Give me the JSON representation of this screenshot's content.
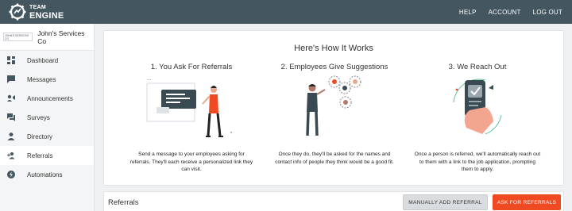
{
  "brand": {
    "line1": "TEAM",
    "line2": "ENGINE"
  },
  "topnav": {
    "help": "HELP",
    "account": "ACCOUNT",
    "logout": "LOG OUT"
  },
  "sidebar": {
    "company_logo_text": "JOHN'S SERVICES CO",
    "company_name": "John's Services Co",
    "items": [
      {
        "label": "Dashboard",
        "icon": "dashboard-icon"
      },
      {
        "label": "Messages",
        "icon": "message-icon"
      },
      {
        "label": "Announcements",
        "icon": "announcement-icon"
      },
      {
        "label": "Surveys",
        "icon": "survey-icon"
      },
      {
        "label": "Directory",
        "icon": "person-icon"
      },
      {
        "label": "Referrals",
        "icon": "referral-icon",
        "active": true
      },
      {
        "label": "Automations",
        "icon": "automation-icon"
      }
    ]
  },
  "how": {
    "title": "Here's How It Works",
    "steps": [
      {
        "title": "1. You Ask For Referrals",
        "desc": "Send a message to your employees asking for referrals. They'll each receive a personalized link they can visit."
      },
      {
        "title": "2. Employees Give Suggestions",
        "desc": "Once they do, they'll be asked for the names and contact info of people they think would be a good fit."
      },
      {
        "title": "3. We Reach Out",
        "desc": "Once a person is referred, we'll automatically reach out to them with a link to the job application, prompting them to apply."
      }
    ]
  },
  "referrals": {
    "title": "Referrals",
    "manual_label": "MANUALLY ADD REFERRAL",
    "ask_label": "ASK FOR REFERRALS"
  },
  "colors": {
    "topbar": "#44565f",
    "accent": "#f04a23",
    "illustration_primary": "#3a4a52",
    "illustration_accent": "#f04a23"
  }
}
